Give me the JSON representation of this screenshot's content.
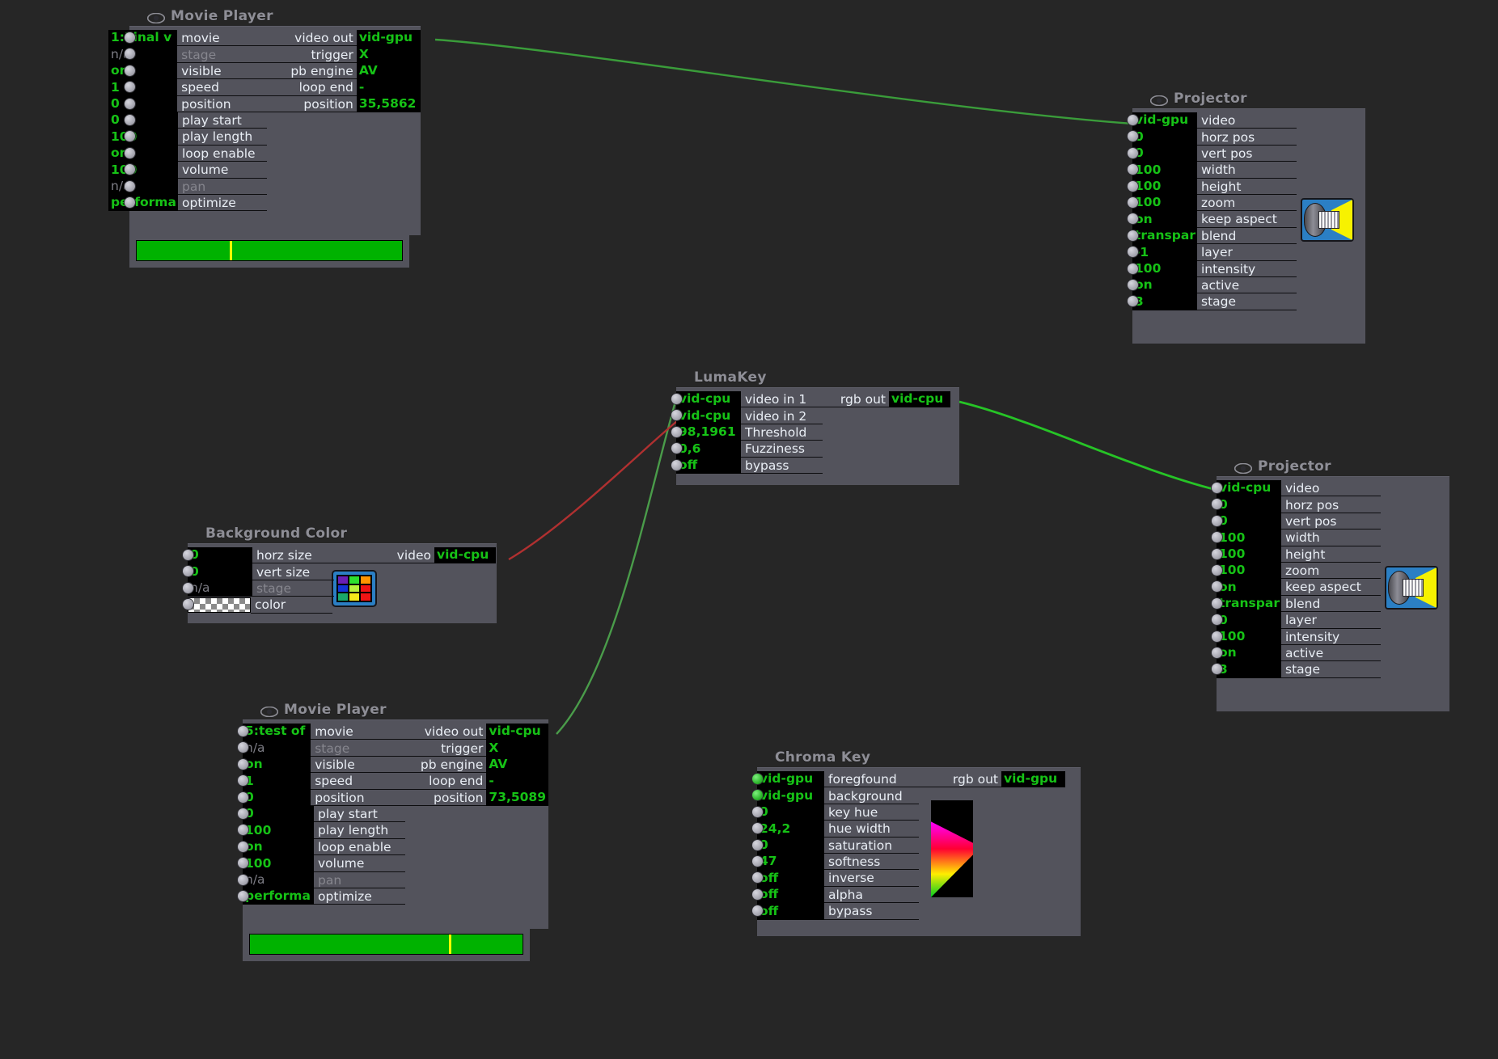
{
  "canvas": {
    "bg": "#262626",
    "panel_bg": "#53535c",
    "value_text": "#16c216",
    "label_text": "#e9eef5",
    "wire_green": "#3a9c3a",
    "wire_red": "#b03030"
  },
  "nodes": {
    "movie_player_1": {
      "title": "Movie Player",
      "icon": "eye-icon",
      "inputs": [
        {
          "value": "1:Final v",
          "label": "movie"
        },
        {
          "value": "n/a",
          "label": "stage",
          "dim": true
        },
        {
          "value": "on",
          "label": "visible"
        },
        {
          "value": "1",
          "label": "speed"
        },
        {
          "value": "0",
          "label": "position"
        },
        {
          "value": "0",
          "label": "play start"
        },
        {
          "value": "100",
          "label": "play length"
        },
        {
          "value": "on",
          "label": "loop enable"
        },
        {
          "value": "100",
          "label": "volume"
        },
        {
          "value": "n/a",
          "label": "pan",
          "dim": true
        },
        {
          "value": "performa",
          "label": "optimize"
        }
      ],
      "outputs": [
        {
          "label": "video out",
          "value": "vid-gpu"
        },
        {
          "label": "trigger",
          "value": "X"
        },
        {
          "label": "pb engine",
          "value": "AV"
        },
        {
          "label": "loop end",
          "value": "-"
        },
        {
          "label": "position",
          "value": "35,5862"
        }
      ],
      "progress_percent": 35
    },
    "movie_player_2": {
      "title": "Movie Player",
      "icon": "eye-icon",
      "inputs": [
        {
          "value": "5:test of",
          "label": "movie"
        },
        {
          "value": "n/a",
          "label": "stage",
          "dim": true
        },
        {
          "value": "on",
          "label": "visible"
        },
        {
          "value": "1",
          "label": "speed"
        },
        {
          "value": "0",
          "label": "position"
        },
        {
          "value": "0",
          "label": "play start"
        },
        {
          "value": "100",
          "label": "play length"
        },
        {
          "value": "on",
          "label": "loop enable"
        },
        {
          "value": "100",
          "label": "volume"
        },
        {
          "value": "n/a",
          "label": "pan",
          "dim": true
        },
        {
          "value": "performa",
          "label": "optimize"
        }
      ],
      "outputs": [
        {
          "label": "video out",
          "value": "vid-cpu"
        },
        {
          "label": "trigger",
          "value": "X"
        },
        {
          "label": "pb engine",
          "value": "AV"
        },
        {
          "label": "loop end",
          "value": "-"
        },
        {
          "label": "position",
          "value": "73,5089"
        }
      ],
      "progress_percent": 73
    },
    "projector_1": {
      "title": "Projector",
      "icon": "eye-icon",
      "inputs": [
        {
          "value": "vid-gpu",
          "label": "video",
          "connected": true
        },
        {
          "value": "0",
          "label": "horz pos"
        },
        {
          "value": "0",
          "label": "vert pos"
        },
        {
          "value": "100",
          "label": "width"
        },
        {
          "value": "100",
          "label": "height"
        },
        {
          "value": "100",
          "label": "zoom"
        },
        {
          "value": "on",
          "label": "keep aspect"
        },
        {
          "value": "transpar",
          "label": "blend"
        },
        {
          "value": "-1",
          "label": "layer"
        },
        {
          "value": "100",
          "label": "intensity"
        },
        {
          "value": "on",
          "label": "active"
        },
        {
          "value": "3",
          "label": "stage"
        }
      ],
      "preview_icon": "projector-icon"
    },
    "projector_2": {
      "title": "Projector",
      "icon": "eye-icon",
      "inputs": [
        {
          "value": "vid-cpu",
          "label": "video",
          "connected": true
        },
        {
          "value": "0",
          "label": "horz pos"
        },
        {
          "value": "0",
          "label": "vert pos"
        },
        {
          "value": "100",
          "label": "width"
        },
        {
          "value": "100",
          "label": "height"
        },
        {
          "value": "100",
          "label": "zoom"
        },
        {
          "value": "on",
          "label": "keep aspect"
        },
        {
          "value": "transpar",
          "label": "blend"
        },
        {
          "value": "0",
          "label": "layer"
        },
        {
          "value": "100",
          "label": "intensity"
        },
        {
          "value": "on",
          "label": "active"
        },
        {
          "value": "3",
          "label": "stage"
        }
      ],
      "preview_icon": "projector-icon"
    },
    "lumakey": {
      "title": "LumaKey",
      "inputs": [
        {
          "value": "vid-cpu",
          "label": "video in 1"
        },
        {
          "value": "vid-cpu",
          "label": "video in 2"
        },
        {
          "value": "98,1961",
          "label": "Threshold"
        },
        {
          "value": "0,6",
          "label": "Fuzziness"
        },
        {
          "value": "off",
          "label": "bypass"
        }
      ],
      "outputs": [
        {
          "label": "rgb out",
          "value": "vid-cpu"
        }
      ]
    },
    "background_color": {
      "title": "Background Color",
      "inputs": [
        {
          "value": "0",
          "label": "horz size"
        },
        {
          "value": "0",
          "label": "vert size"
        },
        {
          "value": "n/a",
          "label": "stage",
          "dim": true
        },
        {
          "value": "",
          "label": "color",
          "swatch": true
        }
      ],
      "outputs": [
        {
          "label": "video",
          "value": "vid-cpu"
        }
      ],
      "preview_icon": "color-grid-icon",
      "grid_colors": [
        "#6a1fb5",
        "#2ee02e",
        "#ff9500",
        "#1433d8",
        "#b9f23c",
        "#f01414",
        "#1aa86a",
        "#f5ea1a",
        "#f01414"
      ]
    },
    "chroma_key": {
      "title": "Chroma Key",
      "inputs": [
        {
          "value": "vid-gpu",
          "label": "foregfound",
          "port_green": true
        },
        {
          "value": "vid-gpu",
          "label": "background",
          "port_green": true
        },
        {
          "value": "0",
          "label": "key hue"
        },
        {
          "value": "24,2",
          "label": "hue width"
        },
        {
          "value": "0",
          "label": "saturation"
        },
        {
          "value": "47",
          "label": "softness"
        },
        {
          "value": "off",
          "label": "inverse"
        },
        {
          "value": "off",
          "label": "alpha"
        },
        {
          "value": "off",
          "label": "bypass"
        }
      ],
      "outputs": [
        {
          "label": "rgb out",
          "value": "vid-gpu"
        }
      ],
      "preview_icon": "hue-wedge-icon"
    }
  },
  "connections": [
    {
      "from": "movie_player_1.video_out",
      "to": "projector_1.video",
      "color": "#3a9c3a"
    },
    {
      "from": "lumakey.rgb_out",
      "to": "projector_2.video",
      "color": "#26c426"
    },
    {
      "from": "movie_player_2.video_out",
      "to": "lumakey.video_in_1",
      "color": "#4a9c4a"
    },
    {
      "from": "background_color.video",
      "to": "lumakey.video_in_2",
      "color": "#b03030"
    }
  ]
}
